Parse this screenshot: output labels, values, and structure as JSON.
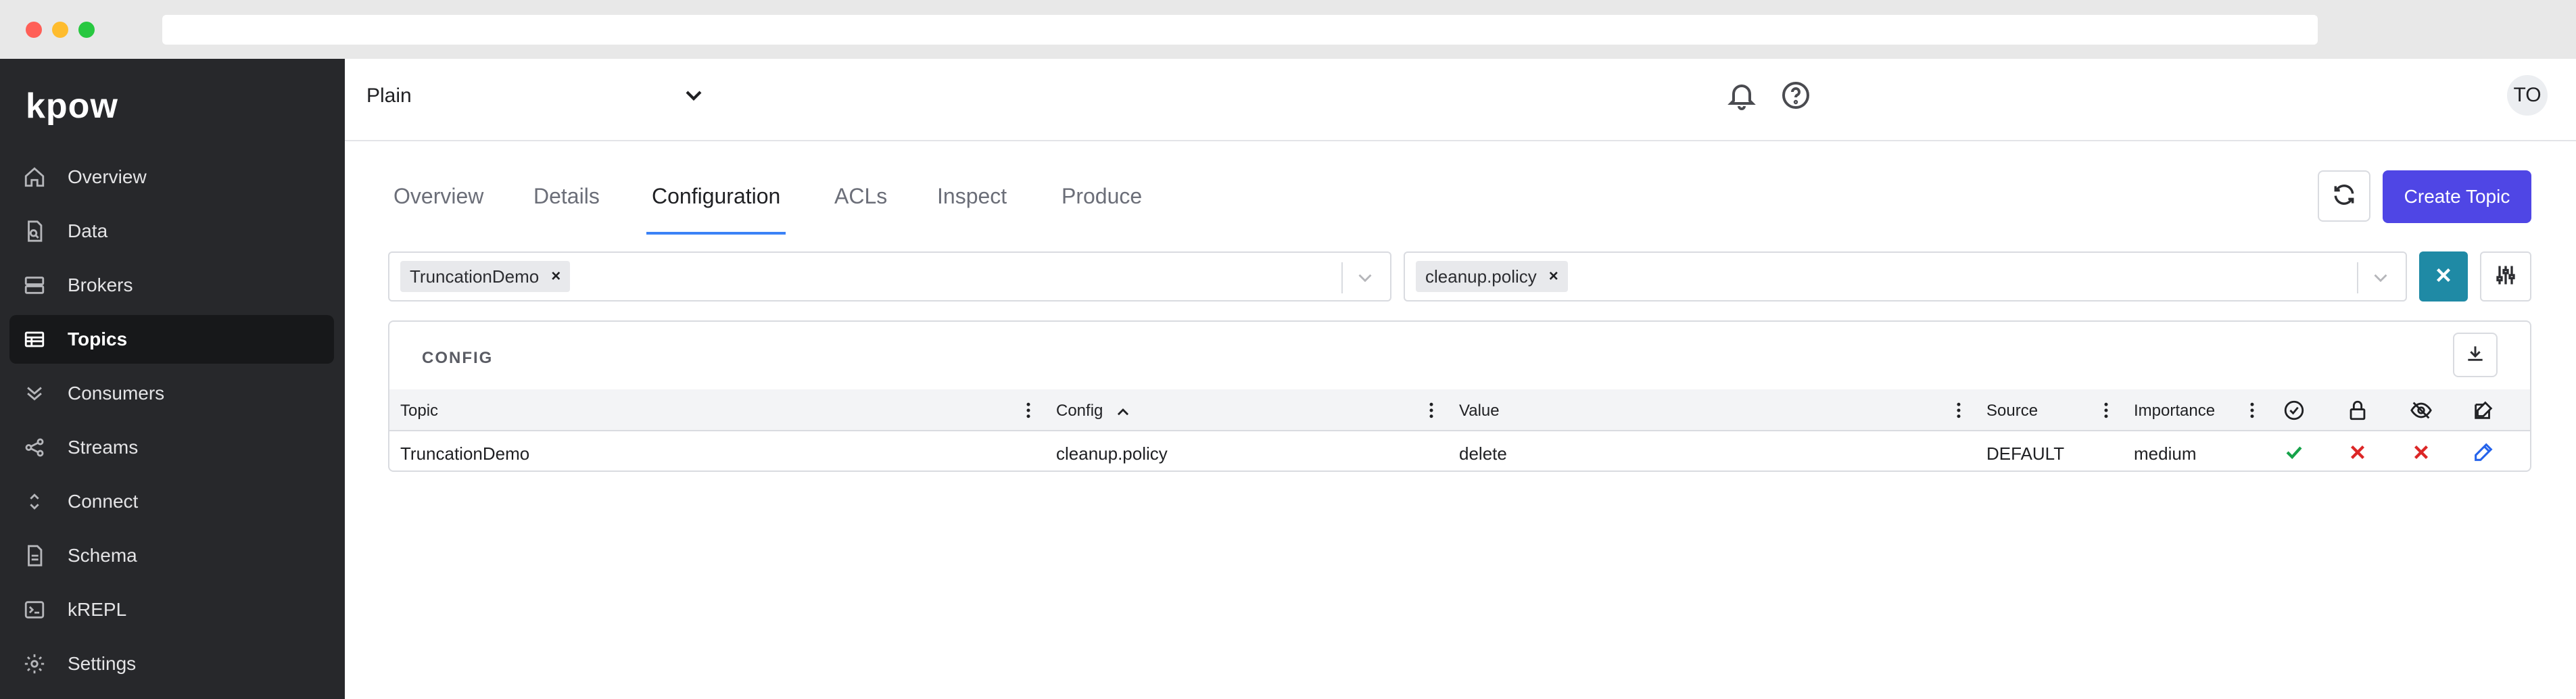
{
  "app": {
    "logo": "kpow"
  },
  "sidebar": {
    "items": [
      {
        "label": "Overview",
        "icon": "home-icon"
      },
      {
        "label": "Data",
        "icon": "file-search-icon"
      },
      {
        "label": "Brokers",
        "icon": "server-icon"
      },
      {
        "label": "Topics",
        "icon": "table-icon",
        "active": true
      },
      {
        "label": "Consumers",
        "icon": "double-chevron-down-icon"
      },
      {
        "label": "Streams",
        "icon": "share-icon"
      },
      {
        "label": "Connect",
        "icon": "chevron-up-down-icon"
      },
      {
        "label": "Schema",
        "icon": "document-icon"
      },
      {
        "label": "kREPL",
        "icon": "terminal-icon"
      },
      {
        "label": "Settings",
        "icon": "gear-icon"
      }
    ]
  },
  "header": {
    "cluster": "Plain",
    "avatar": "TO"
  },
  "tabs": [
    {
      "label": "Overview"
    },
    {
      "label": "Details"
    },
    {
      "label": "Configuration",
      "active": true
    },
    {
      "label": "ACLs"
    },
    {
      "label": "Inspect"
    },
    {
      "label": "Produce"
    }
  ],
  "actions": {
    "create_topic": "Create Topic"
  },
  "filters": {
    "topic_chip": "TruncationDemo",
    "config_chip": "cleanup.policy"
  },
  "panel": {
    "title": "CONFIG",
    "columns": {
      "topic": "Topic",
      "config": "Config",
      "value": "Value",
      "source": "Source",
      "importance": "Importance"
    },
    "rows": [
      {
        "topic": "TruncationDemo",
        "config": "cleanup.policy",
        "value": "delete",
        "source": "DEFAULT",
        "importance": "medium"
      }
    ]
  },
  "colors": {
    "accent": "#4f46e5",
    "tab_underline": "#3b82f6",
    "clear_button": "#1f8aa5",
    "ok": "#16a34a",
    "error": "#dc2626",
    "edit": "#2563eb"
  }
}
